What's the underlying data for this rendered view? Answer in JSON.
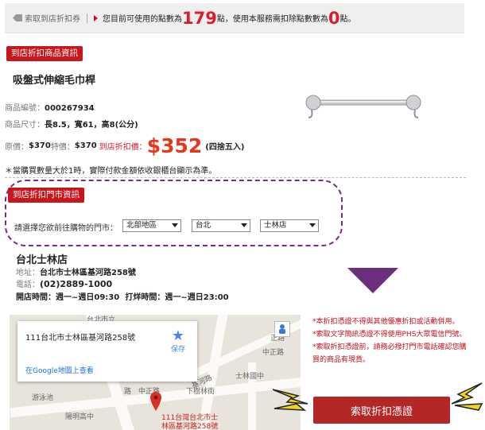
{
  "topbar": {
    "tag_label": "索取到店折扣券",
    "msg_prefix": "您目前可使用的點數為",
    "points_available": "179",
    "msg_mid": "點，使用本服務需扣除點數數為",
    "points_required": "0",
    "msg_suffix": "點。"
  },
  "product": {
    "section_label": "到店折扣商品資訊",
    "name": "吸盤式伸縮毛巾桿",
    "code_label": "商品編號：",
    "code": "000267934",
    "size_label": "商品尺寸：",
    "size": "長8.5，寬61，高8(公分)",
    "orig_label": "原價：",
    "orig_price": "$370",
    "special_label": "特價：",
    "special_price": "$370",
    "store_price_label": "到店折扣價：",
    "store_price": "$352",
    "rounding_note": "(四捨五入)",
    "footnote": "＊當購買數量大於1時，實際付款金額依收銀櫃台顯示為準。"
  },
  "store": {
    "section_label": "到店折扣門市資訊",
    "prompt": "請選擇您欲前往購物的門市：",
    "region": "北部地區",
    "city": "台北",
    "branch": "士林店",
    "name": "台北士林店",
    "addr_label": "地址：",
    "addr": "台北市士林區基河路258號",
    "phone_label": "電話：",
    "phone": "(02)2889-1000",
    "hours_label": "開店時間：",
    "hours": "週一~週日09:30",
    "close_label": "打烊時間：",
    "close": "週一~週日23:00"
  },
  "map": {
    "card_addr": "111台北市士林區基河路258號",
    "save_label": "保存",
    "view_link": "在Google地圖上查看",
    "labels": [
      "台北市立",
      "正路",
      "中正路",
      "士林國中",
      "中正路",
      "基河路",
      "下樹林街",
      "路",
      "游泳池",
      "陽明高中",
      "111台灣台北市士",
      "林區基河路258號"
    ]
  },
  "notes": [
    "*本折扣憑證不得與其他優惠折扣或活動併用。",
    "*索取文字簡訊憑證不得使用PHS大眾電信門號。",
    "*索取折扣憑證前，請務必撥打門市電話確認您購買的商品有現貨。"
  ],
  "cta_label": "索取折扣憑證",
  "colors": {
    "brand_red": "#c8161d",
    "price_orange": "#e4371c",
    "dash_purple": "#7a2a8c",
    "arrow_purple": "#6b2f7e",
    "bolt_yellow": "#f2d51a"
  }
}
